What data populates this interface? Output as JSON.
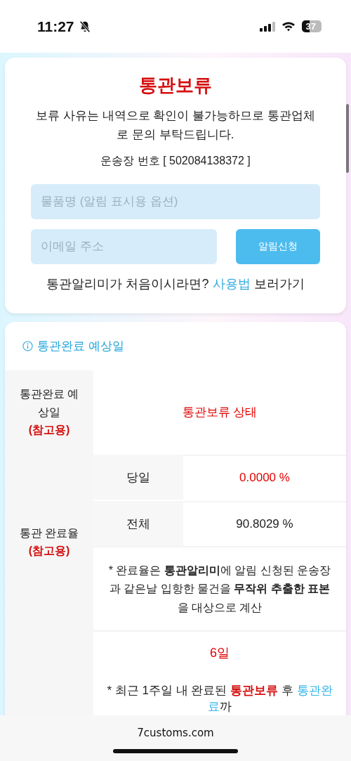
{
  "status_bar": {
    "time": "11:27",
    "silent": true,
    "battery": "37"
  },
  "hold_card": {
    "title": "통관보류",
    "message": "보류 사유는 내역으로 확인이 불가능하므로 통관업체로 문의 부탁드립니다.",
    "tracking": "운송장 번호 [ 502084138372 ]",
    "item_field": {
      "placeholder": "물품명 (알림 표시용 옵션)"
    },
    "email_field": {
      "placeholder": "이메일 주소"
    },
    "subscribe_button": "알림신청",
    "guide": {
      "before": "통관알리미가 처음이시라면?",
      "link": "사용법",
      "after": "보러가기"
    }
  },
  "estimate_card": {
    "heading": "통관완료 예상일",
    "expected": {
      "label": "통관완료 예상일",
      "note": "(참고용)",
      "value": "통관보류 상태"
    },
    "rate": {
      "label": "통관 완료율",
      "note": "(참고용)",
      "rows": [
        {
          "label": "당일",
          "value": "0.0000 %",
          "color": "#e00000"
        },
        {
          "label": "전체",
          "value": "90.8029 %",
          "color": "#222222"
        }
      ],
      "footnote": "* 완료율은 **통관알리미**에 알림 신청된 운송장과 같은날 입항한 물건을 **무작위 추출한 표본**을 대상으로 계산"
    },
    "average": {
      "value": "6일",
      "note": [
        {
          "kind": "plain",
          "text": "* 최근 1주일 내 완료된 "
        },
        {
          "kind": "hold",
          "text": "통관보류"
        },
        {
          "kind": "plain",
          "text": " 후 "
        },
        {
          "kind": "done",
          "text": "통관완료"
        },
        {
          "kind": "plain",
          "text": "까"
        }
      ]
    }
  },
  "browser_bar": {
    "url": "7customs.com"
  }
}
